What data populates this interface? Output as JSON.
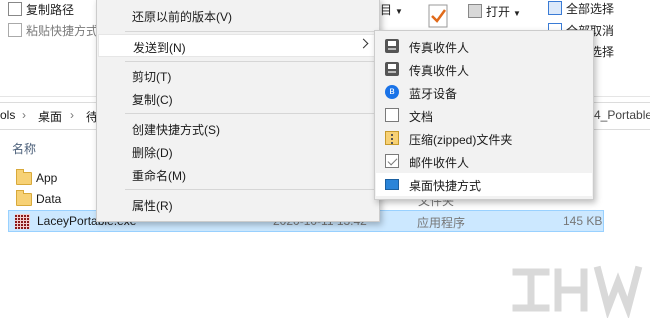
{
  "ribbon": {
    "copy_path": "复制路径",
    "paste_shortcut": "粘贴快捷方式",
    "group_partial": "目",
    "open": "打开",
    "select_all": "全部选择",
    "select_none": "全部取消",
    "invert_select": "反向选择",
    "partial_left": "全部选择"
  },
  "address": {
    "seg1": "ols",
    "seg2": "桌面",
    "seg3": "待",
    "tail": "4_Portable"
  },
  "columns": {
    "name": "名称"
  },
  "files": [
    {
      "name": "App",
      "date": "",
      "type": "",
      "size": ""
    },
    {
      "name": "Data",
      "date": "",
      "type": "文件夹",
      "size": ""
    },
    {
      "name": "LaceyPortable.exe",
      "date": "2020-10-11 13:42",
      "type": "应用程序",
      "size": "145 KB"
    }
  ],
  "context_menu": {
    "restore": "还原以前的版本(V)",
    "send_to": "发送到(N)",
    "cut": "剪切(T)",
    "copy": "复制(C)",
    "create_shortcut": "创建快捷方式(S)",
    "delete": "删除(D)",
    "rename": "重命名(M)",
    "properties": "属性(R)"
  },
  "submenu": [
    {
      "label": "传真收件人",
      "icon": "fax-icon"
    },
    {
      "label": "传真收件人",
      "icon": "fax-icon"
    },
    {
      "label": "蓝牙设备",
      "icon": "bluetooth-icon"
    },
    {
      "label": "文档",
      "icon": "document-icon"
    },
    {
      "label": "压缩(zipped)文件夹",
      "icon": "zip-folder-icon"
    },
    {
      "label": "邮件收件人",
      "icon": "mail-icon"
    },
    {
      "label": "桌面快捷方式",
      "icon": "desktop-icon"
    }
  ],
  "colors": {
    "menu_bg": "#f2f2f2",
    "selected_row": "#cce8ff",
    "highlight": "#ffffff"
  }
}
